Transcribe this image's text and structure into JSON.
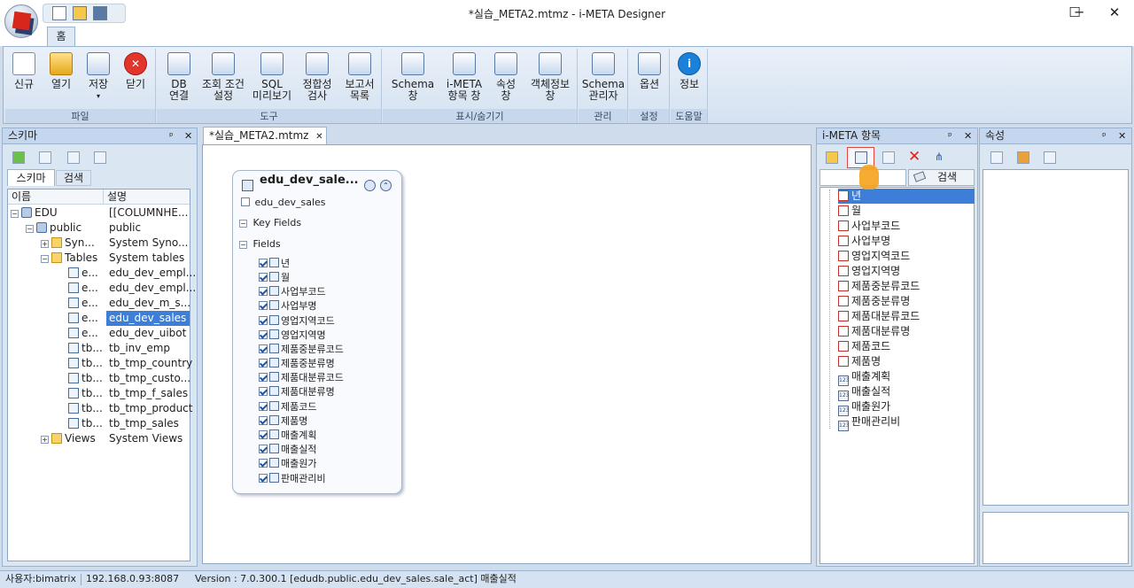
{
  "window": {
    "title": "*실습_META2.mtmz - i-META Designer",
    "minimize": "─",
    "maximize": "☐",
    "close": "✕"
  },
  "ribbon": {
    "home_tab": "홈",
    "groups": [
      {
        "label": "파일",
        "buttons": [
          "신규",
          "열기",
          "저장",
          "닫기"
        ]
      },
      {
        "label": "도구",
        "buttons": [
          "DB\n연결",
          "조회 조건\n설정",
          "SQL\n미리보기",
          "정합성\n검사",
          "보고서\n목록"
        ]
      },
      {
        "label": "표시/숨기기",
        "buttons": [
          "Schema\n창",
          "i-META\n항목 창",
          "속성\n창",
          "객체정보\n창"
        ]
      },
      {
        "label": "관리",
        "buttons": [
          "Schema\n관리자"
        ]
      },
      {
        "label": "설정",
        "buttons": [
          "옵션"
        ]
      },
      {
        "label": "도움말",
        "buttons": [
          "정보"
        ]
      }
    ]
  },
  "schema_panel": {
    "title": "스키마",
    "pin": "ᵖ",
    "close": "✕",
    "tabs": [
      "스키마",
      "검색"
    ],
    "columns": [
      "이름",
      "설명"
    ],
    "rows": [
      {
        "name": "EDU",
        "desc": "[[COLUMNHE..."
      },
      {
        "name": "public",
        "desc": "public"
      },
      {
        "name": "Syn...",
        "desc": "System Syno..."
      },
      {
        "name": "Tables",
        "desc": "System tables"
      },
      {
        "name": "e...",
        "desc": "edu_dev_empl..."
      },
      {
        "name": "e...",
        "desc": "edu_dev_empl..."
      },
      {
        "name": "e...",
        "desc": "edu_dev_m_s..."
      },
      {
        "name": "e...",
        "desc": "edu_dev_sales"
      },
      {
        "name": "e...",
        "desc": "edu_dev_uibot"
      },
      {
        "name": "tb...",
        "desc": "tb_inv_emp"
      },
      {
        "name": "tb...",
        "desc": "tb_tmp_country"
      },
      {
        "name": "tb...",
        "desc": "tb_tmp_custo..."
      },
      {
        "name": "tb...",
        "desc": "tb_tmp_f_sales"
      },
      {
        "name": "tb...",
        "desc": "tb_tmp_product"
      },
      {
        "name": "tb...",
        "desc": "tb_tmp_sales"
      },
      {
        "name": "Views",
        "desc": "System Views"
      }
    ]
  },
  "document": {
    "tab_label": "*실습_META2.mtmz",
    "tab_close": "✕",
    "entity": {
      "title": "edu_dev_sale...",
      "subtitle": "edu_dev_sales",
      "key_fields_label": "Key Fields",
      "fields_label": "Fields",
      "fields": [
        "년",
        "월",
        "사업부코드",
        "사업부명",
        "영업지역코드",
        "영업지역명",
        "제품중분류코드",
        "제품중분류명",
        "제품대분류코드",
        "제품대분류명",
        "제품코드",
        "제품명",
        "매출계획",
        "매출실적",
        "매출원가",
        "판매관리비"
      ]
    }
  },
  "items_panel": {
    "title": "i-META 항목",
    "pin": "ᵖ",
    "close": "✕",
    "search_button": "검색",
    "search_value": "",
    "items": [
      {
        "label": "년",
        "type": "text"
      },
      {
        "label": "월",
        "type": "text"
      },
      {
        "label": "사업부코드",
        "type": "text"
      },
      {
        "label": "사업부명",
        "type": "text"
      },
      {
        "label": "영업지역코드",
        "type": "text"
      },
      {
        "label": "영업지역명",
        "type": "text"
      },
      {
        "label": "제품중분류코드",
        "type": "text"
      },
      {
        "label": "제품중분류명",
        "type": "text"
      },
      {
        "label": "제품대분류코드",
        "type": "text"
      },
      {
        "label": "제품대분류명",
        "type": "text"
      },
      {
        "label": "제품코드",
        "type": "text"
      },
      {
        "label": "제품명",
        "type": "text"
      },
      {
        "label": "매출계획",
        "type": "number"
      },
      {
        "label": "매출실적",
        "type": "number"
      },
      {
        "label": "매출원가",
        "type": "number"
      },
      {
        "label": "판매관리비",
        "type": "number"
      }
    ]
  },
  "props_panel": {
    "title": "속성",
    "pin": "ᵖ",
    "close": "✕"
  },
  "status": {
    "user": "사용자:bimatrix",
    "server": "192.168.0.93:8087",
    "info": "Version : 7.0.300.1  [edudb.public.edu_dev_sales.sale_act] 매출실적"
  }
}
